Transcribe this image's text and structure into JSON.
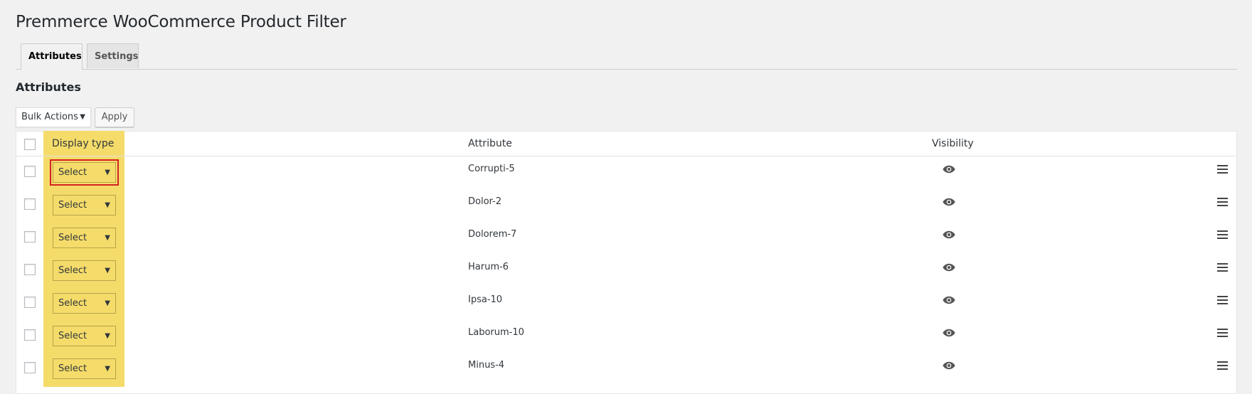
{
  "page": {
    "title": "Premmerce WooCommerce Product Filter"
  },
  "tabs": [
    {
      "label": "Attributes",
      "active": true
    },
    {
      "label": "Settings",
      "active": false
    }
  ],
  "section": {
    "title": "Attributes"
  },
  "bulk": {
    "selected": "Bulk Actions",
    "apply_label": "Apply"
  },
  "table": {
    "columns": {
      "display_type": "Display type",
      "attribute": "Attribute",
      "visibility": "Visibility"
    },
    "highlight_color": "#f5dc6a",
    "rows": [
      {
        "display_type": "Select",
        "attribute": "Corrupti-5",
        "visible": true,
        "visibility_icon": "eye-icon",
        "handle_icon": "drag-handle-icon"
      },
      {
        "display_type": "Select",
        "attribute": "Dolor-2",
        "visible": true,
        "visibility_icon": "eye-icon",
        "handle_icon": "drag-handle-icon"
      },
      {
        "display_type": "Select",
        "attribute": "Dolorem-7",
        "visible": true,
        "visibility_icon": "eye-icon",
        "handle_icon": "drag-handle-icon"
      },
      {
        "display_type": "Select",
        "attribute": "Harum-6",
        "visible": true,
        "visibility_icon": "eye-icon",
        "handle_icon": "drag-handle-icon"
      },
      {
        "display_type": "Select",
        "attribute": "Ipsa-10",
        "visible": true,
        "visibility_icon": "eye-icon",
        "handle_icon": "drag-handle-icon"
      },
      {
        "display_type": "Select",
        "attribute": "Laborum-10",
        "visible": true,
        "visibility_icon": "eye-icon",
        "handle_icon": "drag-handle-icon"
      },
      {
        "display_type": "Select",
        "attribute": "Minus-4",
        "visible": true,
        "visibility_icon": "eye-icon",
        "handle_icon": "drag-handle-icon"
      }
    ]
  }
}
